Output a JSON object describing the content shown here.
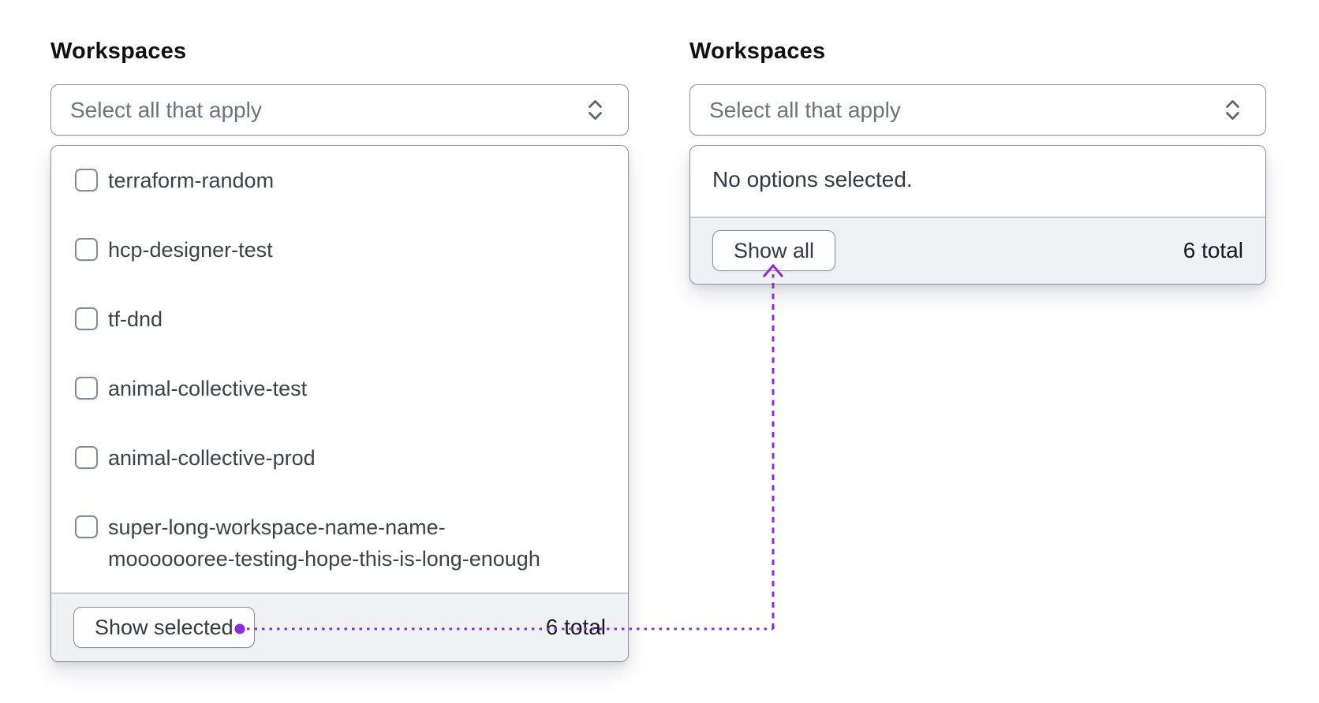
{
  "theme": {
    "annotation_purple": "#8E2BDB",
    "border_gray": "#8A909C",
    "footer_bg": "#F0F1F2",
    "placeholder_gray": "#6C7380"
  },
  "left_component": {
    "label": "Workspaces",
    "select": {
      "placeholder": "Select all that apply"
    },
    "dropdown": {
      "options": [
        {
          "label": "terraform-random",
          "checked": false
        },
        {
          "label": "hcp-designer-test",
          "checked": false
        },
        {
          "label": "tf-dnd",
          "checked": false
        },
        {
          "label": "animal-collective-test",
          "checked": false
        },
        {
          "label": "animal-collective-prod",
          "checked": false
        },
        {
          "label": "super-long-workspace-name-name-\nmooooooree-testing-hope-this-is-long-enough",
          "checked": false
        }
      ],
      "footer": {
        "button_label": "Show selected",
        "total": "6 total"
      }
    }
  },
  "right_component": {
    "label": "Workspaces",
    "select": {
      "placeholder": "Select all that apply"
    },
    "dropdown": {
      "empty_message": "No options selected.",
      "footer": {
        "button_label": "Show all",
        "total": "6 total"
      }
    }
  }
}
